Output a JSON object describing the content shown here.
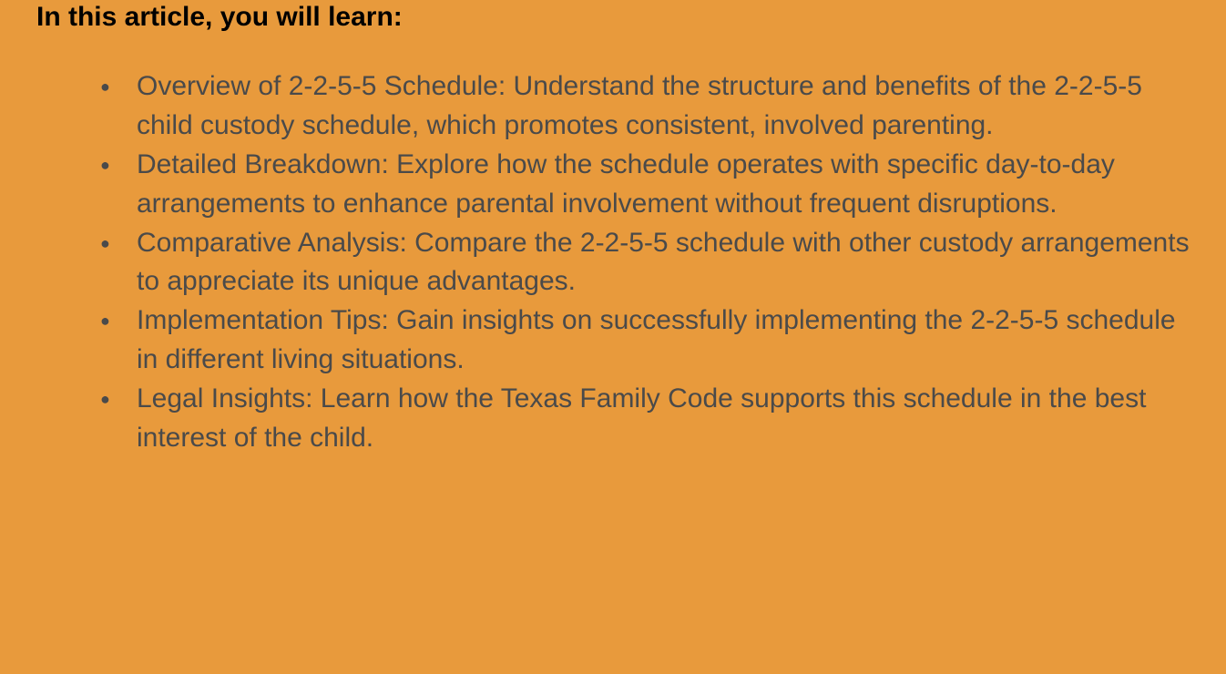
{
  "heading": "In this article, you will learn:",
  "bullets": [
    "Overview of 2-2-5-5 Schedule: Understand the structure and benefits of the 2-2-5-5 child custody schedule, which promotes consistent, involved parenting.",
    "Detailed Breakdown: Explore how the schedule operates with specific day-to-day arrangements to enhance parental involvement without frequent disruptions.",
    "Comparative Analysis: Compare the 2-2-5-5 schedule with other custody arrangements to appreciate its unique advantages.",
    "Implementation Tips: Gain insights on successfully implementing the 2-2-5-5 schedule in different living situations.",
    "Legal Insights: Learn how the Texas Family Code supports this schedule in the best interest of the child."
  ]
}
